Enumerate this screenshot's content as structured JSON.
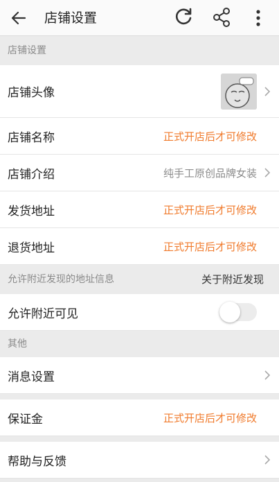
{
  "header": {
    "title": "店铺设置",
    "icons": [
      "back-arrow-icon",
      "refresh-icon",
      "share-icon",
      "more-icon"
    ]
  },
  "section_store": {
    "title": "店铺设置",
    "rows": [
      {
        "label": "店铺头像",
        "type": "avatar"
      },
      {
        "label": "店铺名称",
        "value": "正式开店后才可修改"
      },
      {
        "label": "店铺介绍",
        "value": "纯手工原创品牌女装"
      },
      {
        "label": "发货地址",
        "value": "正式开店后才可修改"
      },
      {
        "label": "退货地址",
        "value": "正式开店后才可修改"
      }
    ]
  },
  "section_nearby": {
    "title": "允许附近发现的地址信息",
    "link": "关于附近发现",
    "toggle_label": "允许附近可见",
    "toggle_on": false
  },
  "section_other": {
    "title": "其他",
    "rows": [
      {
        "label": "消息设置"
      },
      {
        "label": "保证金",
        "value": "正式开店后才可修改"
      },
      {
        "label": "帮助与反馈"
      }
    ]
  },
  "colors": {
    "accent": "#f07a2b",
    "background": "#ebebeb",
    "muted": "#8c8c8c"
  }
}
